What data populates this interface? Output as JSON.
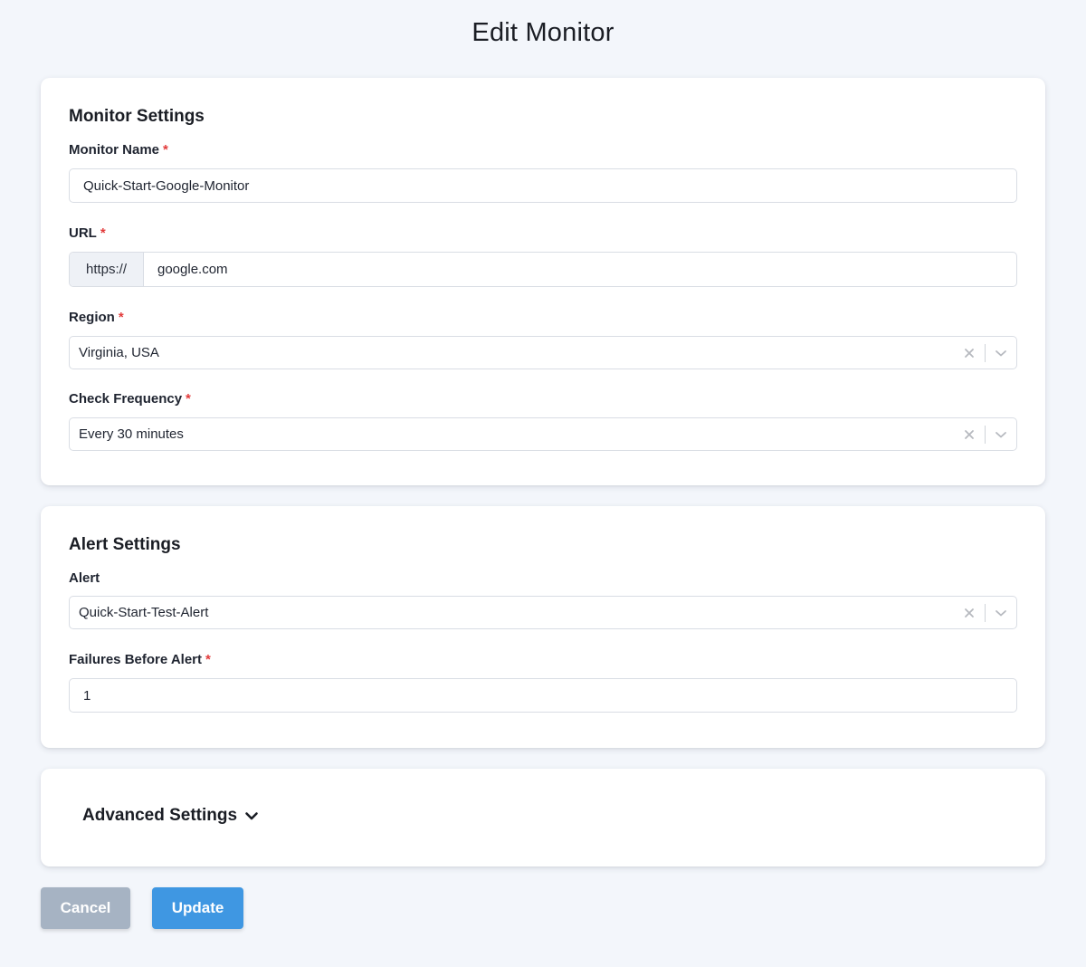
{
  "page": {
    "title": "Edit Monitor"
  },
  "monitor_settings": {
    "title": "Monitor Settings",
    "name": {
      "label": "Monitor Name",
      "required": "*",
      "value": "Quick-Start-Google-Monitor"
    },
    "url": {
      "label": "URL",
      "required": "*",
      "prefix": "https://",
      "value": "google.com"
    },
    "region": {
      "label": "Region",
      "required": "*",
      "value": "Virginia, USA"
    },
    "frequency": {
      "label": "Check Frequency",
      "required": "*",
      "value": "Every 30 minutes"
    }
  },
  "alert_settings": {
    "title": "Alert Settings",
    "alert": {
      "label": "Alert",
      "value": "Quick-Start-Test-Alert"
    },
    "failures": {
      "label": "Failures Before Alert",
      "required": "*",
      "value": "1"
    }
  },
  "advanced": {
    "label": "Advanced Settings",
    "icon": "chevron-down-icon"
  },
  "actions": {
    "cancel_label": "Cancel",
    "update_label": "Update"
  },
  "colors": {
    "background": "#f3f6fb",
    "required": "#e23b3b",
    "cancel_button": "#a6b3c3",
    "update_button": "#3f97e2"
  },
  "icons": {
    "clear": "close-icon",
    "dropdown": "chevron-down-icon"
  }
}
